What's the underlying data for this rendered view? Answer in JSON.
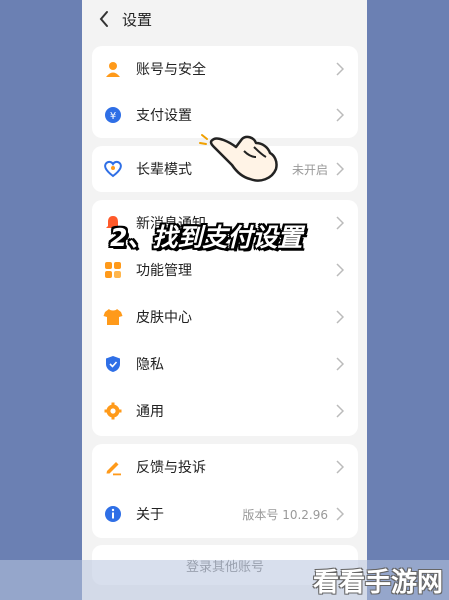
{
  "header": {
    "title": "设置"
  },
  "account_group": [
    {
      "label": "账号与安全",
      "icon": "person-icon"
    },
    {
      "label": "支付设置",
      "icon": "yuan-coin-icon"
    }
  ],
  "elder_group": [
    {
      "label": "长辈模式",
      "value": "未开启",
      "icon": "heart-icon"
    }
  ],
  "general_group": [
    {
      "label": "新消息通知",
      "icon": "bell-icon"
    },
    {
      "label": "功能管理",
      "icon": "grid-icon"
    },
    {
      "label": "皮肤中心",
      "icon": "shirt-icon"
    },
    {
      "label": "隐私",
      "icon": "shield-icon"
    },
    {
      "label": "通用",
      "icon": "gear-icon"
    }
  ],
  "about_group": [
    {
      "label": "反馈与投诉",
      "icon": "edit-icon"
    },
    {
      "label": "关于",
      "value": "版本号 10.2.96",
      "icon": "info-icon"
    }
  ],
  "login_other": "登录其他账号",
  "overlay_caption": "2、找到支付设置",
  "watermark": "看看手游网",
  "colors": {
    "accent_orange": "#ff9a1a",
    "accent_blue": "#2f6fe6",
    "background": "#6b80b3"
  }
}
